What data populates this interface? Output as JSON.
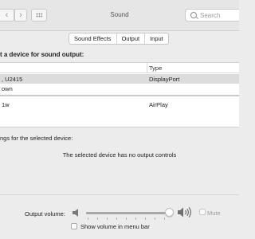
{
  "window": {
    "title": "Sound"
  },
  "search": {
    "placeholder": "Search"
  },
  "tabs": [
    {
      "label": "Sound Effects"
    },
    {
      "label": "Output"
    },
    {
      "label": "Input"
    }
  ],
  "output": {
    "heading": "t a device for sound output:",
    "columns": [
      "",
      "Type"
    ],
    "devices": [
      {
        "name": ", U2415",
        "type": "DisplayPort"
      },
      {
        "name": "own",
        "type": ""
      },
      {
        "name": "1w",
        "type": "AirPlay"
      }
    ],
    "settings_label": "ngs for the selected device:",
    "no_controls_message": "The selected device has no output controls"
  },
  "volume": {
    "label": "Output volume:",
    "level": 0.94,
    "mute_label": "Mute",
    "mute_checked": false
  },
  "menu_bar": {
    "label": "Show volume in menu bar",
    "checked": false
  }
}
